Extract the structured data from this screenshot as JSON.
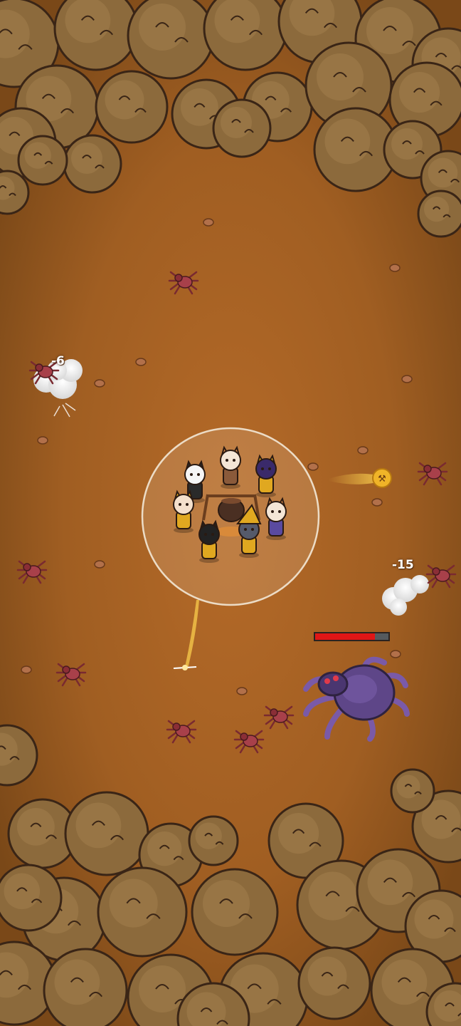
{
  "hud": {
    "damage_left": "-6",
    "damage_right": "-15"
  },
  "boss": {
    "health_fraction": 0.82
  },
  "colors": {
    "ground": "#a86324",
    "tree": "#8c6a3c",
    "tree_outline": "#3a2516",
    "hp_fill": "#e01616",
    "zone_ring": "#e8dcc8",
    "spider": "#a8404a",
    "boss": "#6a4a8c"
  },
  "icons": {
    "coin": "hammer-coin-icon"
  }
}
